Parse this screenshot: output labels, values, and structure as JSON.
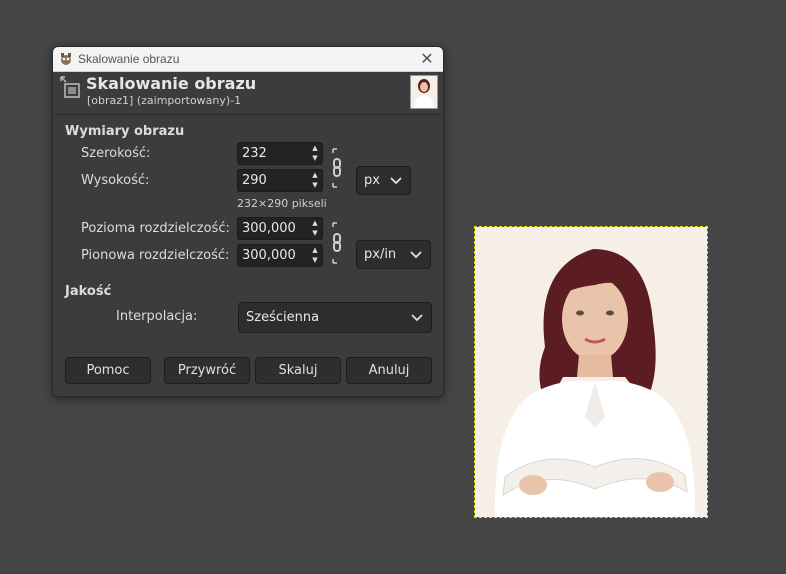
{
  "window": {
    "title": "Skalowanie obrazu"
  },
  "header": {
    "title": "Skalowanie obrazu",
    "subtitle": "[obraz1] (zaimportowany)-1"
  },
  "size_section": {
    "title": "Wymiary obrazu",
    "width_label": "Szerokość:",
    "width_value": "232",
    "height_label": "Wysokość:",
    "height_value": "290",
    "pixel_info": "232×290 pikseli",
    "unit": "px",
    "xres_label": "Pozioma rozdzielczość:",
    "xres_value": "300,000",
    "yres_label": "Pionowa rozdzielczość:",
    "yres_value": "300,000",
    "res_unit": "px/in"
  },
  "quality_section": {
    "title": "Jakość",
    "interp_label": "Interpolacja:",
    "interp_value": "Sześcienna"
  },
  "buttons": {
    "help": "Pomoc",
    "reset": "Przywróć",
    "scale": "Skaluj",
    "cancel": "Anuluj"
  },
  "icons": {
    "window": "gimp-wilber-icon",
    "header": "scale-image-icon",
    "chain": "chain-link-icon",
    "dropdown": "chevron-down-icon",
    "close": "close-icon"
  },
  "colors": {
    "dialog_bg": "#3c3c3c",
    "workspace_bg": "#454545",
    "selection_border": "#e4e400"
  }
}
